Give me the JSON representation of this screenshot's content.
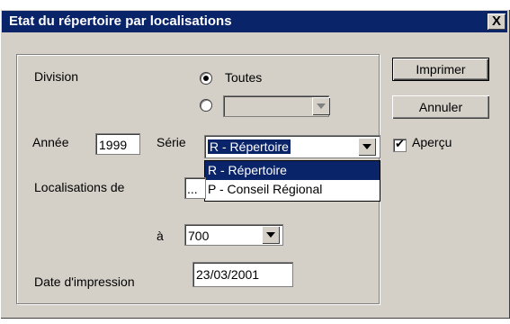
{
  "window": {
    "title": "Etat du répertoire par localisations",
    "close_label": "X"
  },
  "division": {
    "label": "Division",
    "option_all": "Toutes",
    "option_select_value": ""
  },
  "annee": {
    "label": "Année",
    "value": "1999"
  },
  "serie": {
    "label": "Série",
    "selected": "R - Répertoire",
    "options": [
      "R - Répertoire",
      "P - Conseil Régional"
    ]
  },
  "localisations": {
    "label": "Localisations de",
    "from_value": "...",
    "to_label": "à",
    "to_value": "700"
  },
  "date_impression": {
    "label": "Date d'impression",
    "value": "23/03/2001"
  },
  "buttons": {
    "print": "Imprimer",
    "cancel": "Annuler"
  },
  "apercu": {
    "label": "Aperçu",
    "checked": true
  },
  "colors": {
    "titlebar": "#0a246a",
    "face": "#d4d0c8",
    "highlight": "#0a246a"
  }
}
